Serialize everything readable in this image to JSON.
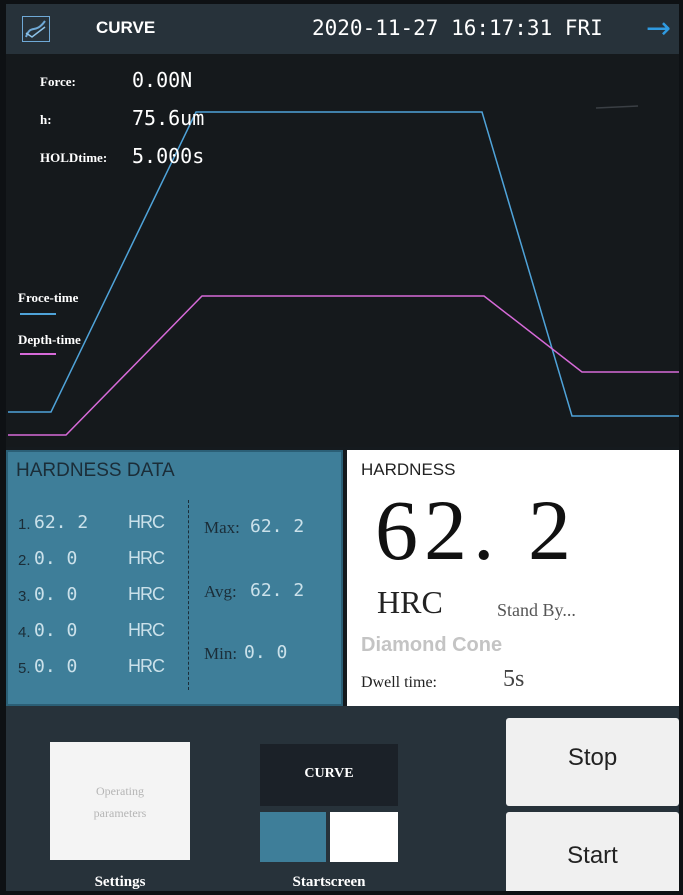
{
  "header": {
    "icon": "curve-chart-icon",
    "title": "CURVE",
    "datetime": "2020-11-27 16:17:31 FRI",
    "next_icon": "arrow-right-icon"
  },
  "curve": {
    "readouts": [
      {
        "label": "Force:",
        "value": "0.00N"
      },
      {
        "label": "h:",
        "value": "75.6um"
      },
      {
        "label": "HOLDtime:",
        "value": "5.000s"
      }
    ],
    "legend": [
      {
        "label": "Froce-time",
        "color": "#4fa3d9"
      },
      {
        "label": "Depth-time",
        "color": "#d66ad8"
      }
    ]
  },
  "hardness_data": {
    "title": "HARDNESS DATA",
    "rows": [
      {
        "index": "1.",
        "value": "62. 2",
        "unit": "HRC"
      },
      {
        "index": "2.",
        "value": "0. 0",
        "unit": "HRC"
      },
      {
        "index": "3.",
        "value": "0. 0",
        "unit": "HRC"
      },
      {
        "index": "4.",
        "value": "0. 0",
        "unit": "HRC"
      },
      {
        "index": "5.",
        "value": "0. 0",
        "unit": "HRC"
      }
    ],
    "max_label": "Max:",
    "max_value": "62. 2",
    "avg_label": "Avg:",
    "avg_value": "62. 2",
    "min_label": "Min:",
    "min_value": "0. 0"
  },
  "hardness": {
    "title": "HARDNESS",
    "value": "62. 2",
    "unit": "HRC",
    "status": "Stand  By...",
    "indenter": "Diamond Cone",
    "dwell_label": "Dwell time:",
    "dwell_value": "5s"
  },
  "bottom": {
    "settings_box_text": [
      "Operating",
      "parameters"
    ],
    "settings_label": "Settings",
    "curve_button": "CURVE",
    "startscreen_label": "Startscreen",
    "stop_button": "Stop",
    "start_button": "Start"
  },
  "colors": {
    "header_bg": "#27323a",
    "panel_blue": "#3e7e99",
    "force_line": "#4fa3d9",
    "depth_line": "#d66ad8"
  }
}
